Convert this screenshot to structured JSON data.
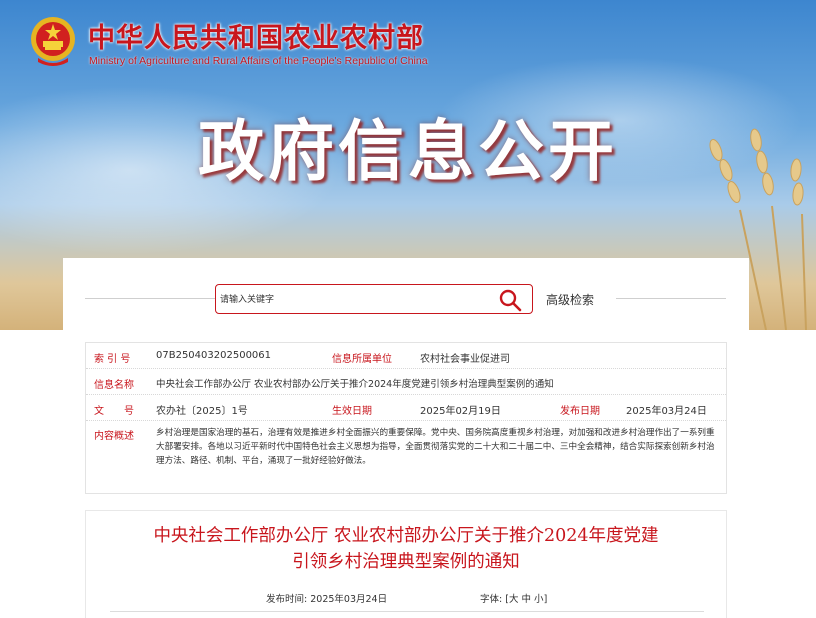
{
  "header": {
    "ministry_cn": "中华人民共和国农业农村部",
    "ministry_en": "Ministry of Agriculture and Rural Affairs of the People's Republic of China",
    "banner_title": "政府信息公开"
  },
  "search": {
    "placeholder": "请输入关键字",
    "advanced_label": "高级检索"
  },
  "info": {
    "index_label": "索 引 号",
    "index_value": "07B250403202500061",
    "org_label": "信息所属单位",
    "org_value": "农村社会事业促进司",
    "name_label": "信息名称",
    "name_value": "中央社会工作部办公厅 农业农村部办公厅关于推介2024年度党建引领乡村治理典型案例的通知",
    "docno_label": "文　　号",
    "docno_value": "农办社〔2025〕1号",
    "created_label": "生效日期",
    "created_value": "2025年02月19日",
    "published_label": "发布日期",
    "published_value": "2025年03月24日",
    "summary_label": "内容概述",
    "summary_value": "乡村治理是国家治理的基石，治理有效是推进乡村全面振兴的重要保障。党中央、国务院高度重视乡村治理，对加强和改进乡村治理作出了一系列重大部署安排。各地以习近平新时代中国特色社会主义思想为指导，全面贯彻落实党的二十大和二十届二中、三中全会精神，结合实际探索创新乡村治理方法、路径、机制、平台，涌现了一批好经验好做法。"
  },
  "article": {
    "title_line1": "中央社会工作部办公厅 农业农村部办公厅关于推介2024年度党建",
    "title_line2": "引领乡村治理典型案例的通知",
    "date_label": "发布时间:",
    "date_value": "2025年03月24日",
    "font_label": "字体:",
    "font_open": "[",
    "font_large": "大",
    "font_medium": "中",
    "font_small": "小",
    "font_close": "]"
  },
  "colors": {
    "accent_red": "#c8161d",
    "text": "#333333"
  },
  "icons": {
    "emblem": "national-emblem-icon",
    "search": "search-icon"
  }
}
